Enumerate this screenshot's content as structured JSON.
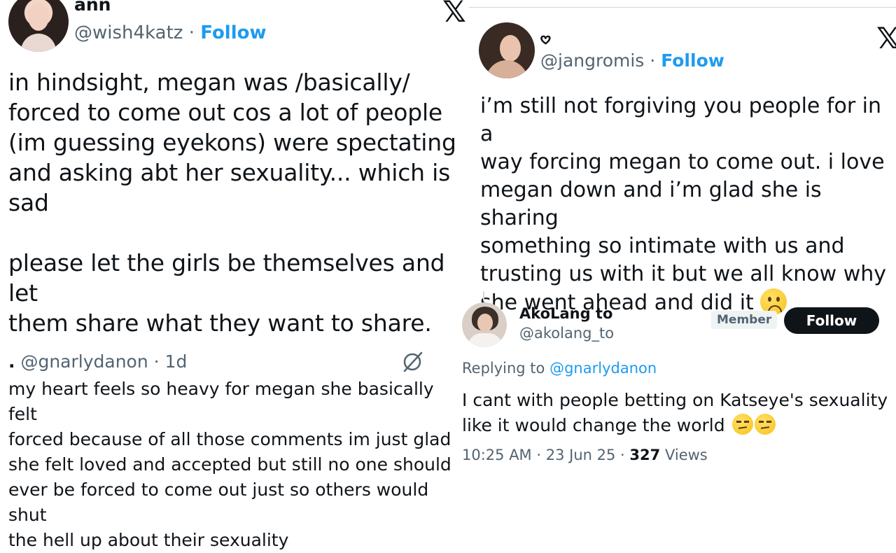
{
  "tweet_left": {
    "name": "ann",
    "handle": "@wish4katz",
    "separator": "·",
    "follow_label": "Follow",
    "body_lines": [
      "in hindsight, megan was /basically/",
      "forced to come out cos a lot of people",
      "(im guessing eyekons) were spectating",
      "and asking abt her sexuality... which is",
      "sad"
    ],
    "body_lines_2": [
      "please let the girls be themselves and let",
      "them share what they want to share."
    ]
  },
  "quoted_left": {
    "prefix": ".",
    "handle": "@gnarlydanon",
    "separator": "·",
    "time": "1d",
    "body_lines": [
      "my heart feels so heavy for megan she basically felt",
      "forced because of all those comments im just glad",
      "she felt loved and accepted but still no one should",
      "ever be forced to come out just so others would shut",
      "the hell up about their sexuality"
    ]
  },
  "tweet_right": {
    "name": "𖹭",
    "handle": "@jangromis",
    "separator": "·",
    "follow_label": "Follow",
    "body_lines": [
      "i’m still not forgiving you people for in a",
      "way forcing megan to come out. i love",
      "megan down and i’m glad she is sharing",
      "something so intimate with us and",
      "trusting us with it but we all know why",
      "she went ahead and did it"
    ]
  },
  "reply_right": {
    "name": "AkoLang to",
    "handle": "@akolang_to",
    "badge": "Member",
    "follow_label": "Follow",
    "replying_prefix": "Replying to",
    "replying_handle": "@gnarlydanon",
    "body_lines": [
      "I cant with people betting on Katseye's sexuality",
      "like it would change the world"
    ],
    "time": "10:25 AM",
    "date": "23 Jun 25",
    "views_count": "327",
    "views_label": "Views",
    "separator": "·"
  },
  "icons": {
    "x_logo": "x-logo-icon",
    "spiral": "spiral-icon",
    "emoji_sad": "slightly-frowning-face-emoji",
    "emoji_unamused": "unamused-face-emoji"
  },
  "colors": {
    "link": "#1d9bf0",
    "text": "#0f1419",
    "muted": "#536471"
  }
}
